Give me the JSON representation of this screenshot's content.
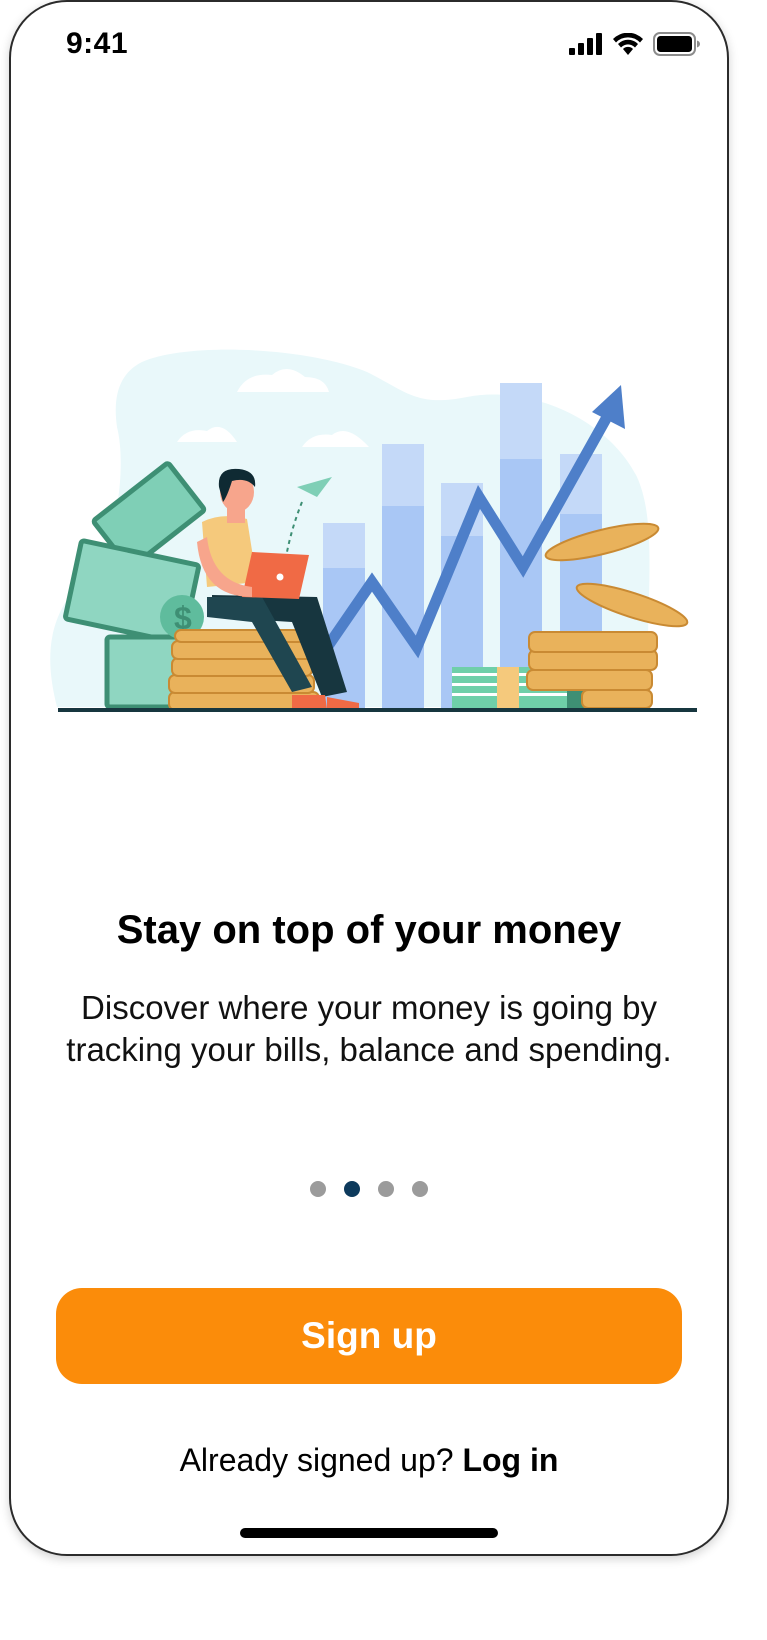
{
  "status_bar": {
    "time": "9:41"
  },
  "onboarding": {
    "headline": "Stay on top of your money",
    "description": "Discover where your money is going by tracking your bills, balance and spending.",
    "page_count": 4,
    "active_page": 2
  },
  "actions": {
    "signup_label": "Sign up",
    "login_prompt": "Already signed up?",
    "login_label": "Log in"
  },
  "colors": {
    "accent": "#fb8c0a",
    "active_dot": "#0d3a5c",
    "inactive_dot": "#9b9b9b"
  },
  "icons": {
    "signal": "signal-bars-icon",
    "wifi": "wifi-icon",
    "battery": "battery-icon"
  }
}
